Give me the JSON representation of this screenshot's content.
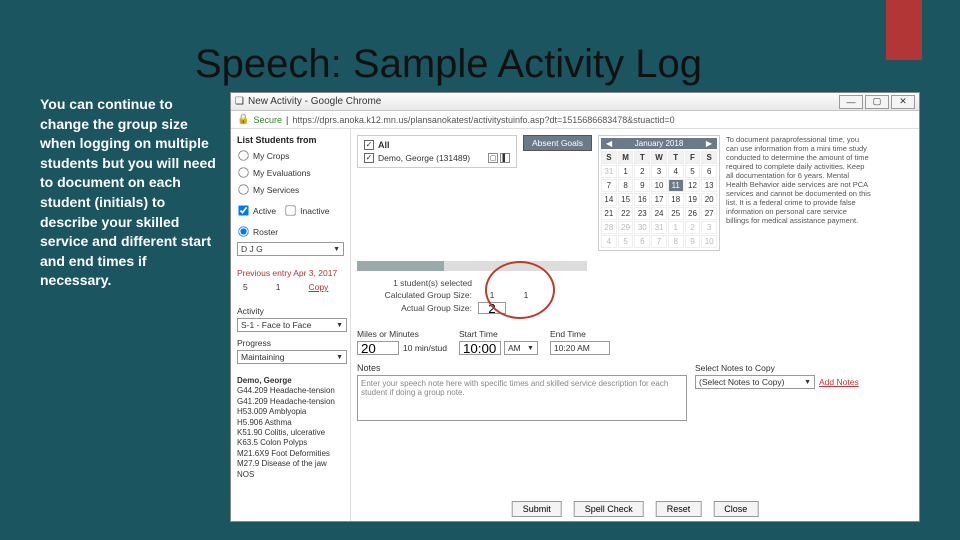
{
  "slide": {
    "title": "Speech:  Sample Activity Log",
    "caption": "You can continue to change the group size when logging on multiple students but you will need to document on each student (initials) to describe your skilled service and different start and end times if necessary."
  },
  "window": {
    "title": "New Activity - Google Chrome",
    "secure_label": "Secure",
    "url": "https://dprs.anoka.k12.mn.us/plansanokatest/activitystuinfo.asp?dt=1515686683478&stuactid=0"
  },
  "left": {
    "heading": "List Students from",
    "opt1": "My Crops",
    "opt2": "My Evaluations",
    "opt3": "My Services",
    "active": "Active",
    "inactive": "Inactive",
    "roster": "Roster",
    "roster_val": "D J G",
    "prev_label": "Previous entry Apr 3, 2017",
    "prev_a": "5",
    "prev_b": "1",
    "copy": "Copy"
  },
  "mid": {
    "all": "All",
    "student": "Demo, George (131489)",
    "absent_goals": "Absent Goals",
    "students_selected": "1 student(s) selected",
    "calc_label": "Calculated Group Size:",
    "calc_val": "1",
    "actual_label": "Actual Group Size:",
    "actual_val": "2"
  },
  "calendar": {
    "month": "January 2018",
    "dow": [
      "S",
      "M",
      "T",
      "W",
      "T",
      "F",
      "S"
    ],
    "rows": [
      [
        "31",
        "1",
        "2",
        "3",
        "4",
        "5",
        "6"
      ],
      [
        "7",
        "8",
        "9",
        "10",
        "11",
        "12",
        "13"
      ],
      [
        "14",
        "15",
        "16",
        "17",
        "18",
        "19",
        "20"
      ],
      [
        "21",
        "22",
        "23",
        "24",
        "25",
        "26",
        "27"
      ],
      [
        "28",
        "29",
        "30",
        "31",
        "1",
        "2",
        "3"
      ],
      [
        "4",
        "5",
        "6",
        "7",
        "8",
        "9",
        "10"
      ]
    ],
    "selected": "11"
  },
  "disclaimer": "To document paraprofessional time, you can use information from a mini time study conducted to determine the amount of time required to complete daily activities. Keep all documentation for 6 years. Mental Health Behavior aide services are not PCA services and cannot be documented on this list. It is a federal crime to provide false information on personal care service billings for medical assistance payment.",
  "fields": {
    "activity_label": "Activity",
    "activity_val": "S-1 - Face to Face",
    "progress_label": "Progress",
    "progress_val": "Maintaining",
    "miles_label": "Miles or Minutes",
    "miles_val": "20",
    "miles_unit": "10 min/stud",
    "start_label": "Start Time",
    "start_val": "10:00",
    "ampm": "AM",
    "end_label": "End Time",
    "end_val": "10:20 AM",
    "notes_label": "Notes",
    "notes_placeholder": "Enter your speech note here with specific times and skilled service description for each student if doing a group note.",
    "select_notes_label": "Select Notes to Copy",
    "select_notes_val": "(Select Notes to Copy)",
    "add_notes": "Add Notes"
  },
  "dx": {
    "name": "Demo, George",
    "lines": [
      "G44.209 Headache-tension",
      "G41.209 Headache-tension",
      "H53.009 Amblyopia",
      "H5.906 Asthma",
      "K51.90  Colitis, ulcerative",
      "K63.5   Colon Polyps",
      "M21.6X9 Foot Deformities",
      "M27.9   Disease of the jaw NOS"
    ]
  },
  "buttons": {
    "submit": "Submit",
    "spell": "Spell Check",
    "reset": "Reset",
    "close": "Close"
  }
}
